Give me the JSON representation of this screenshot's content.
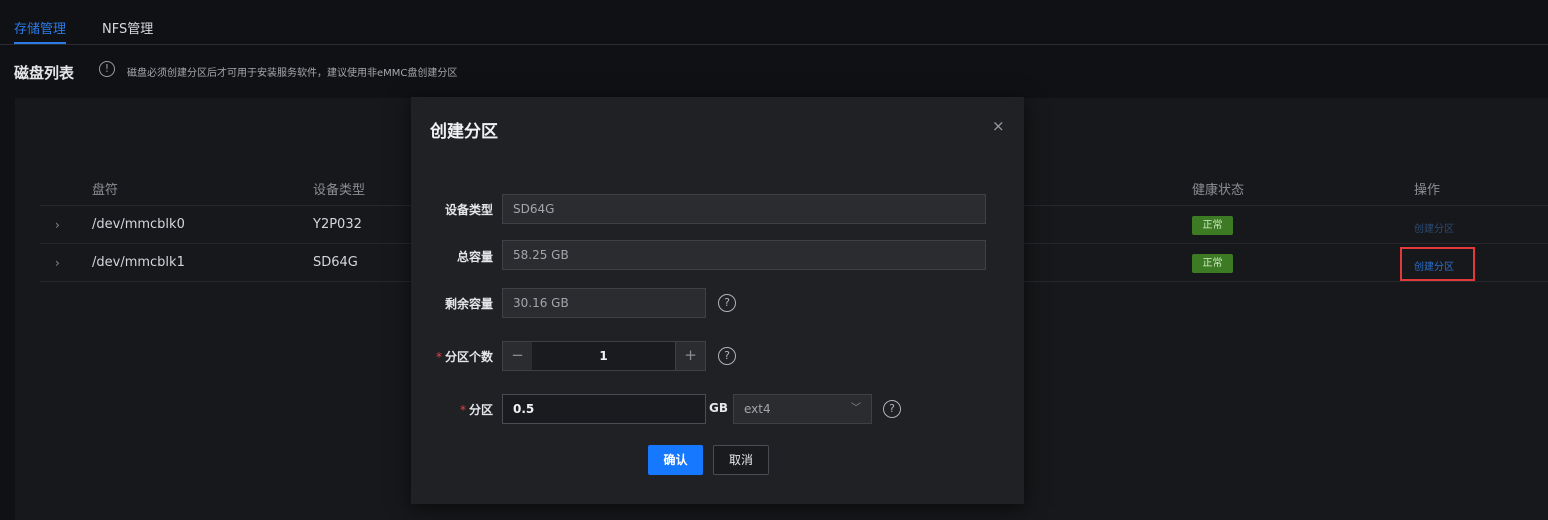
{
  "tabs": [
    {
      "label": "存储管理",
      "active": true
    },
    {
      "label": "NFS管理",
      "active": false
    }
  ],
  "disk_list": {
    "title": "磁盘列表",
    "notice": "磁盘必须创建分区后才可用于安装服务软件，建议使用非eMMC盘创建分区",
    "columns": [
      "盘符",
      "设备类型",
      "健康状态",
      "操作"
    ],
    "rows": [
      {
        "device": "/dev/mmcblk0",
        "type": "Y2P032",
        "health": "正常",
        "action": "创建分区"
      },
      {
        "device": "/dev/mmcblk1",
        "type": "SD64G",
        "health": "正常",
        "action": "创建分区"
      }
    ]
  },
  "modal": {
    "title": "创建分区",
    "close": "×",
    "fields": {
      "device_type_label": "设备类型",
      "device_type_value": "SD64G",
      "total_label": "总容量",
      "total_value": "58.25 GB",
      "remaining_label": "剩余容量",
      "remaining_value": "30.16 GB",
      "count_label": "分区个数",
      "count_value": "1",
      "partition_label": "分区",
      "partition_value": "0.5",
      "unit": "GB",
      "fs_type": "ext4"
    },
    "confirm": "确认",
    "cancel": "取消"
  },
  "colors": {
    "accent": "#1677ff",
    "healthy": "#3d7a24",
    "highlight": "#e03a3a",
    "required": "#e04545"
  }
}
